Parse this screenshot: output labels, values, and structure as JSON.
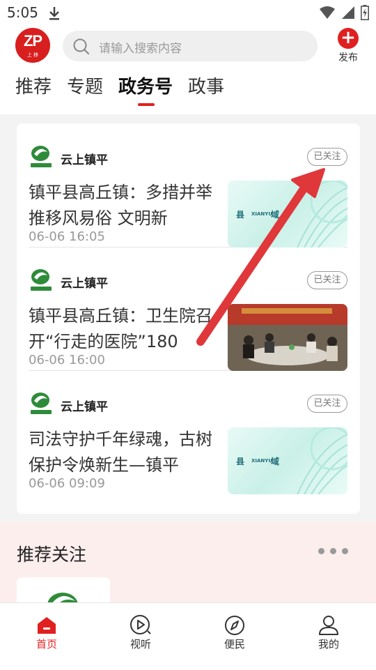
{
  "status": {
    "time": "5:05"
  },
  "header": {
    "logo_text": "ZP",
    "logo_sub": "上 移",
    "search_placeholder": "请输入搜索内容",
    "publish_label": "发布"
  },
  "tabs": [
    {
      "label": "推荐"
    },
    {
      "label": "专题"
    },
    {
      "label": "政务号",
      "active": true
    },
    {
      "label": "政事"
    }
  ],
  "items": [
    {
      "account": "云上镇平",
      "follow": "已关注",
      "title": "镇平县高丘镇：多措并举推移风易俗 文明新",
      "date": "06-06 16:05",
      "thumb_left": "县",
      "thumb_mid": "XIANYU",
      "thumb_right": "域"
    },
    {
      "account": "云上镇平",
      "follow": "已关注",
      "title": "镇平县高丘镇：卫生院召开“行走的医院”180",
      "date": "06-06 16:00"
    },
    {
      "account": "云上镇平",
      "follow": "已关注",
      "title": "司法守护千年绿魂，古树保护令焕新生—镇平",
      "date": "06-06 09:09",
      "thumb_left": "县",
      "thumb_mid": "XIANYU",
      "thumb_right": "域"
    }
  ],
  "recommend": {
    "title": "推荐关注"
  },
  "nav": [
    {
      "label": "首页",
      "active": true
    },
    {
      "label": "视听"
    },
    {
      "label": "便民"
    },
    {
      "label": "我的"
    }
  ],
  "colors": {
    "accent": "#e02020",
    "annotation_arrow": "#e0373b"
  }
}
